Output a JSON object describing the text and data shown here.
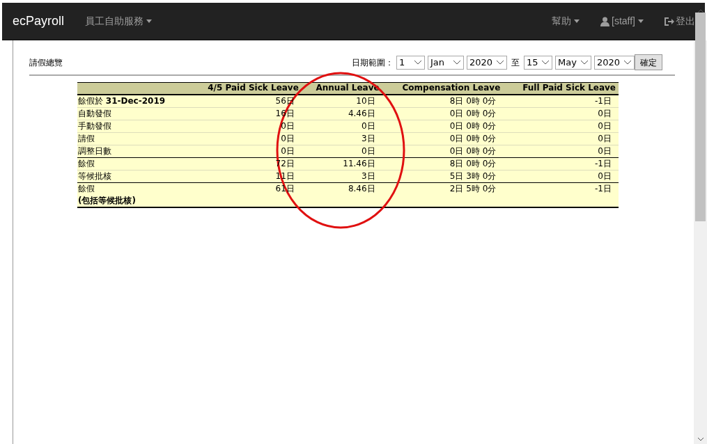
{
  "navbar": {
    "brand": "ecPayroll",
    "menu": "員工自助服務",
    "help": "幫助",
    "user": "[staff]",
    "logout": "登出"
  },
  "page": {
    "title": "請假總覽",
    "range_label": "日期範圍：",
    "from": [
      "1",
      "Jan",
      "2020"
    ],
    "to_label": "至",
    "to": [
      "15",
      "May",
      "2020"
    ],
    "submit": "確定"
  },
  "table": {
    "columns": [
      "",
      "4/5 Paid Sick Leave",
      "Annual Leave",
      "Compensation Leave",
      "Full Paid Sick Leave"
    ],
    "rows": [
      {
        "kind": "normal",
        "cells": [
          "餘假於 **31-Dec-2019**",
          "56日",
          "10日",
          "8日 0時 0分",
          "-1日"
        ]
      },
      {
        "kind": "normal",
        "cells": [
          "自動發假",
          "16日",
          "4.46日",
          "0日 0時 0分",
          "0日"
        ]
      },
      {
        "kind": "normal",
        "cells": [
          "手動發假",
          "0日",
          "0日",
          "0日 0時 0分",
          "0日"
        ]
      },
      {
        "kind": "normal",
        "cells": [
          "請假",
          "0日",
          "3日",
          "0日 0時 0分",
          "0日"
        ]
      },
      {
        "kind": "normal",
        "cells": [
          "調整日數",
          "0日",
          "0日",
          "0日 0時 0分",
          "0日"
        ]
      },
      {
        "kind": "total",
        "cells": [
          "餘假",
          "72日",
          "11.46日",
          "8日 0時 0分",
          "-1日"
        ]
      },
      {
        "kind": "normal",
        "cells": [
          "等候批核",
          "11日",
          "3日",
          "5日 3時 0分",
          "0日"
        ]
      },
      {
        "kind": "total",
        "cells": [
          "餘假\n**(包括等候批核)**",
          "61日",
          "8.46日",
          "2日 5時 0分",
          "-1日"
        ]
      }
    ]
  }
}
